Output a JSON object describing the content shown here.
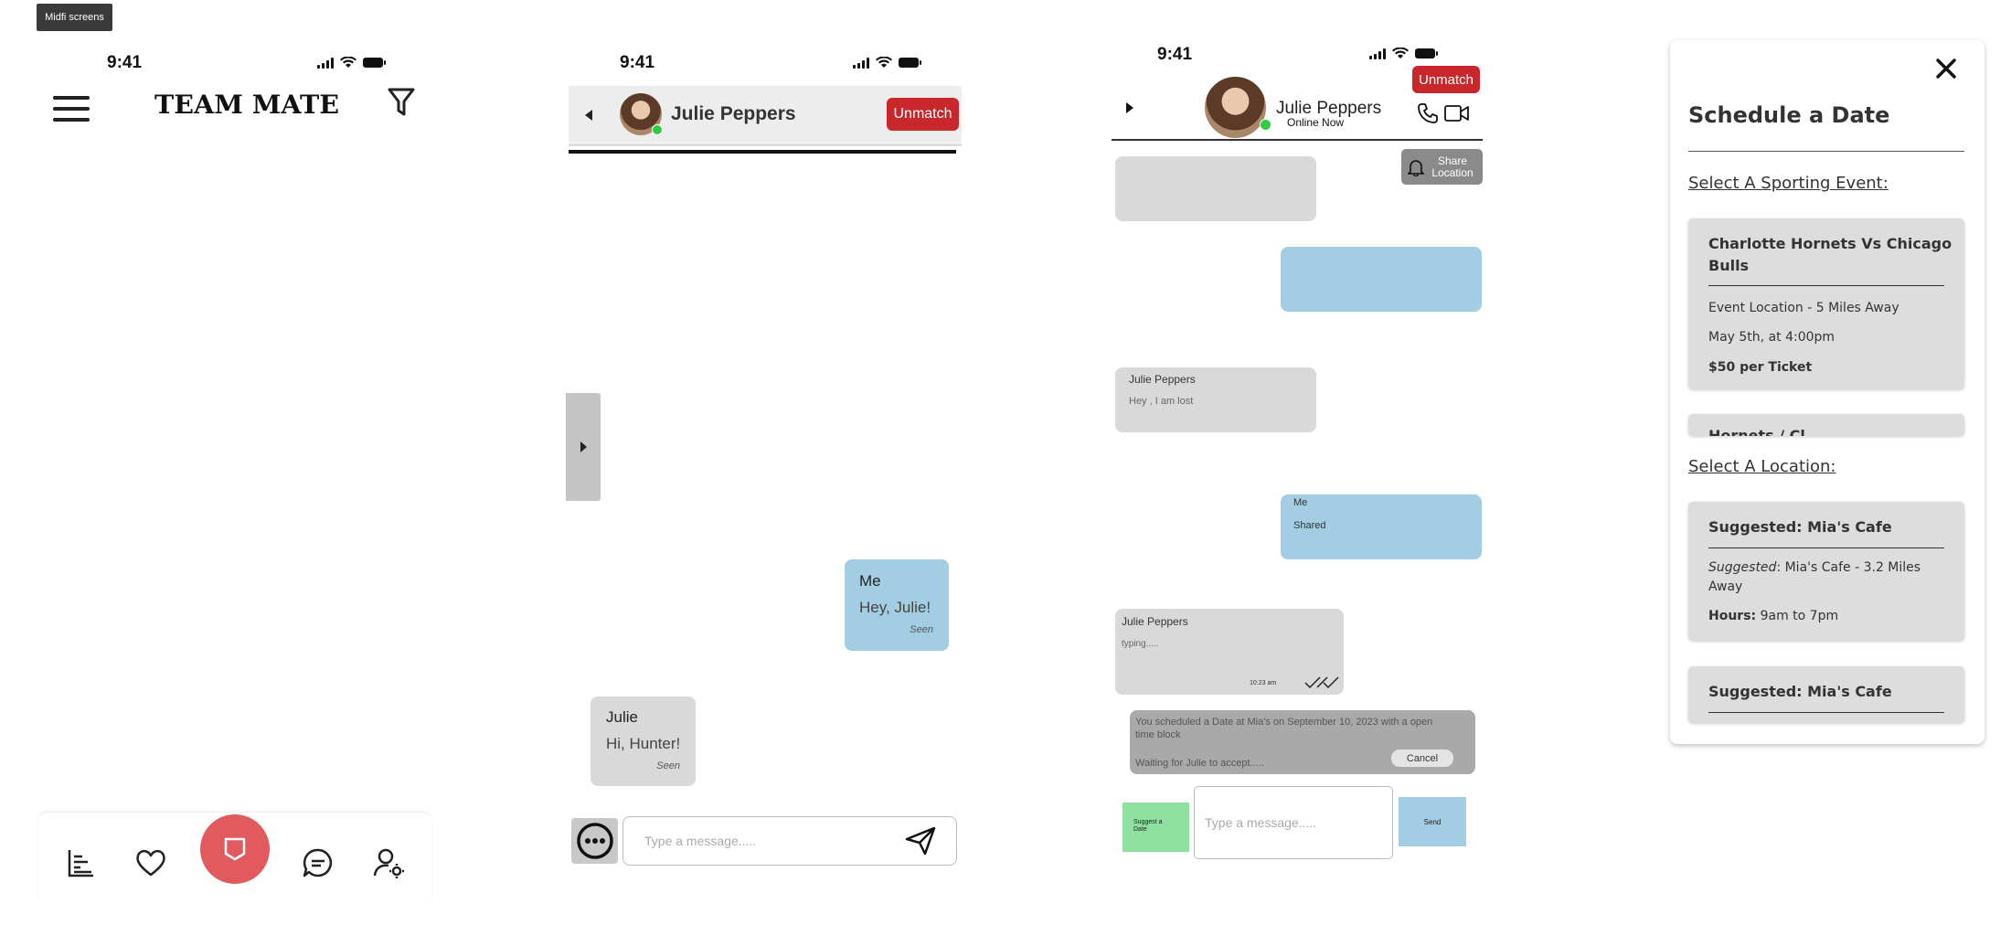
{
  "canvas_label": "Midfi screens",
  "status": {
    "time": "9:41"
  },
  "screen1": {
    "brand": "TEAM MATE",
    "nav": {
      "items": [
        "stats-icon",
        "heart-icon",
        "chat-shield-icon",
        "message-icon",
        "profile-settings-icon"
      ],
      "accent": "#e05a5e"
    }
  },
  "screen2": {
    "contact_name": "Julie Peppers",
    "unmatch_label": "Unmatch",
    "messages": [
      {
        "sender": "Me",
        "text": "Hey, Julie!",
        "status": "Seen"
      },
      {
        "sender": "Julie",
        "text": "Hi, Hunter!",
        "status": "Seen"
      }
    ],
    "input_placeholder": "Type a message....."
  },
  "screen3": {
    "contact_name": "Julie Peppers",
    "presence": "Online Now",
    "unmatch_label": "Unmatch",
    "share_location_label": "Share Location",
    "messages": [
      {
        "sender": "Julie Peppers",
        "text": "Hey , I am lost"
      },
      {
        "sender": "Me",
        "text": "Shared"
      },
      {
        "sender": "Julie Peppers",
        "text": "typing.....",
        "time": "10:23 am"
      }
    ],
    "date_notice": {
      "text": "You scheduled a Date at Mia's on September 10, 2023 with a open time block",
      "waiting": "Waiting for Julie to accept.....",
      "cancel_label": "Cancel"
    },
    "suggest_label": "Suggest a Date",
    "input_placeholder": "Type a message.....",
    "send_label": "Send",
    "colors": {
      "mine": "#a3cde3",
      "theirs": "#d9d9d9",
      "suggest": "#8ee0a0"
    }
  },
  "screen4": {
    "title": "Schedule a Date",
    "event_section": "Select A Sporting Event:",
    "event": {
      "title": "Charlotte Hornets Vs Chicago Bulls",
      "location": "Event Location - 5 Miles Away",
      "datetime": "May 5th, at 4:00pm",
      "price": "$50 per Ticket"
    },
    "event_peek": "Hornets / Cl...",
    "location_section": "Select A Location:",
    "location": {
      "title": "Suggested: Mia's Cafe",
      "suggested_prefix": "Suggested",
      "suggested_text": ": Mia's Cafe - 3.2 Miles Away",
      "hours_label": "Hours:",
      "hours_value": "9am to 7pm"
    },
    "location2_title": "Suggested: Mia's Cafe"
  }
}
